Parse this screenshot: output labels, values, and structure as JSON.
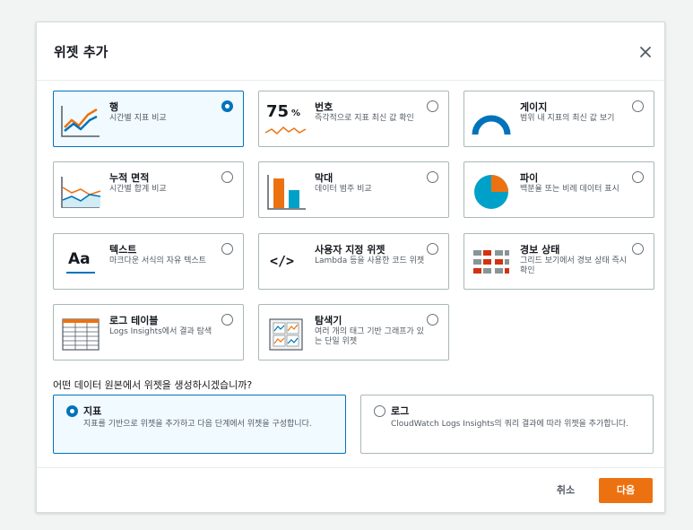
{
  "modal": {
    "title": "위젯 추가",
    "close_icon": "close-icon"
  },
  "widgets": [
    {
      "key": "line",
      "title": "행",
      "desc": "시간별 지표 비교",
      "icon": "line-chart-icon",
      "selected": true
    },
    {
      "key": "number",
      "title": "번호",
      "desc": "즉각적으로 지표 최신 값 확인",
      "icon": "number-icon",
      "number_label": "75",
      "percent_label": "%",
      "selected": false
    },
    {
      "key": "gauge",
      "title": "게이지",
      "desc": "범위 내 지표의 최신 값 보기",
      "icon": "gauge-icon",
      "selected": false
    },
    {
      "key": "stacked",
      "title": "누적 면적",
      "desc": "시간별 합계 비교",
      "icon": "stacked-area-icon",
      "selected": false
    },
    {
      "key": "bar",
      "title": "막대",
      "desc": "데이터 범주 비교",
      "icon": "bar-chart-icon",
      "selected": false
    },
    {
      "key": "pie",
      "title": "파이",
      "desc": "백분율 또는 비례 데이터 표시",
      "icon": "pie-chart-icon",
      "selected": false
    },
    {
      "key": "text",
      "title": "텍스트",
      "desc": "마크다운 서식의 자유 텍스트",
      "icon": "text-icon",
      "glyph": "Aa",
      "selected": false
    },
    {
      "key": "custom",
      "title": "사용자 지정 위젯",
      "desc": "Lambda 등을 사용한 코드 위젯",
      "icon": "code-icon",
      "glyph": "</>",
      "selected": false
    },
    {
      "key": "alarm",
      "title": "경보 상태",
      "desc": "그리드 보기에서 경보 상태 즉시 확인",
      "icon": "alarm-grid-icon",
      "selected": false
    },
    {
      "key": "logs",
      "title": "로그 테이블",
      "desc": "Logs Insights에서 결과 탐색",
      "icon": "table-icon",
      "selected": false
    },
    {
      "key": "explorer",
      "title": "탐색기",
      "desc": "여러 개의 태그 기반 그래프가 있는 단일 위젯",
      "icon": "explorer-icon",
      "selected": false
    }
  ],
  "source": {
    "question": "어떤 데이터 원본에서 위젯을 생성하시겠습니까?",
    "options": [
      {
        "key": "metrics",
        "title": "지표",
        "desc": "지표를 기반으로 위젯을 추가하고 다음 단계에서 위젯을 구성합니다.",
        "selected": true
      },
      {
        "key": "logs",
        "title": "로그",
        "desc": "CloudWatch Logs Insights의 쿼리 결과에 따라 위젯을 추가합니다.",
        "selected": false
      }
    ]
  },
  "footer": {
    "cancel_label": "취소",
    "next_label": "다음"
  },
  "colors": {
    "accent": "#0073bb",
    "primary_button": "#ec7211",
    "chart_orange": "#ec7211",
    "chart_blue": "#0073bb",
    "chart_teal": "#00a1c9",
    "alarm_red": "#d13212"
  }
}
